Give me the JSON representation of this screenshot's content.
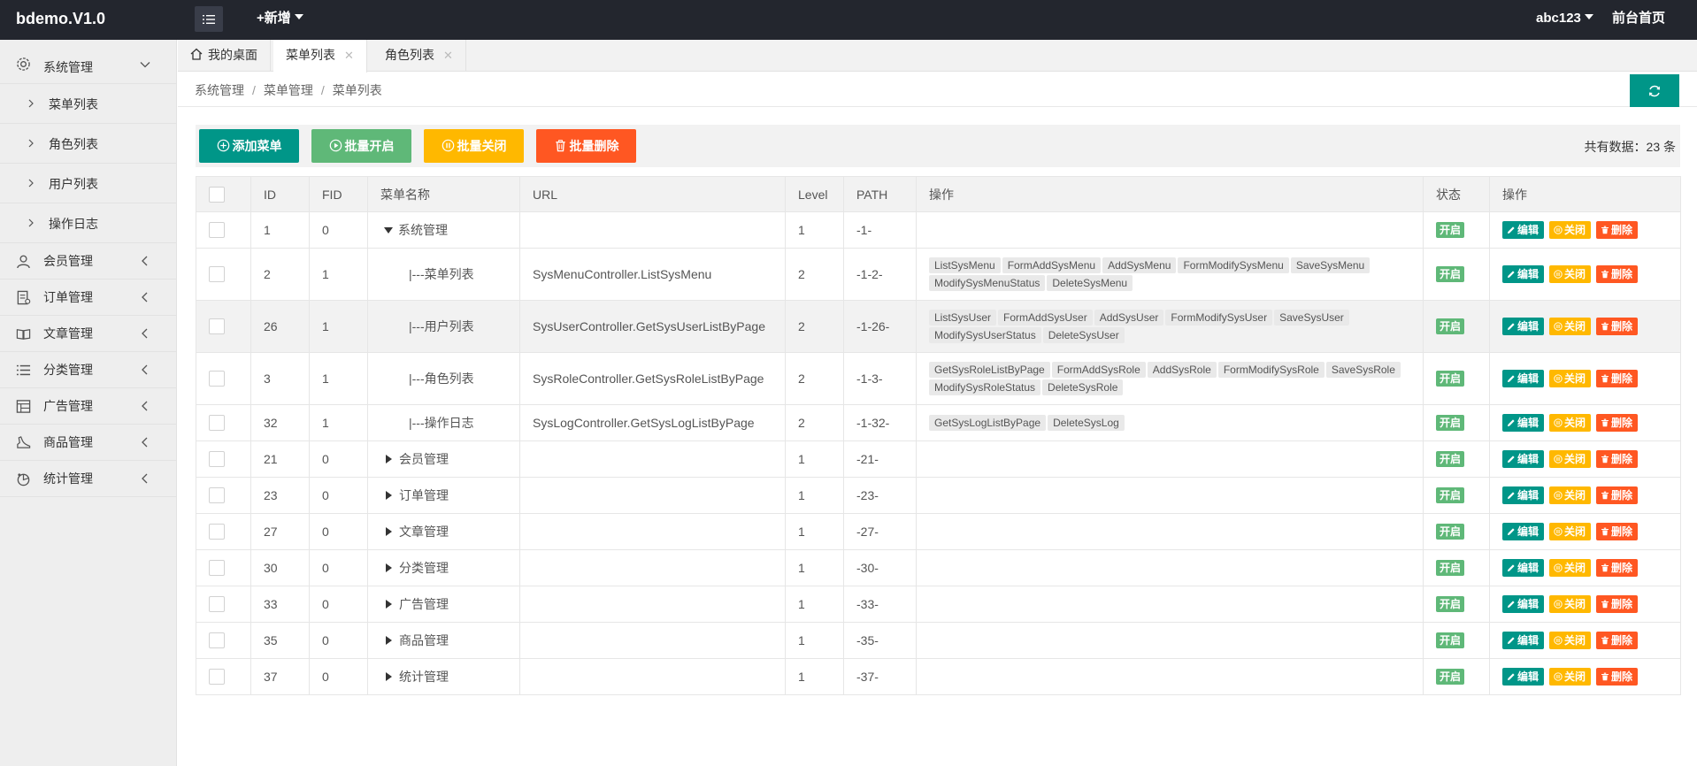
{
  "app": {
    "logo": "bdemo.V1.0",
    "add_new": "+新增",
    "user": "abc123",
    "front_home": "前台首页"
  },
  "sidebar": {
    "system": {
      "label": "系统管理",
      "subitems": [
        "菜单列表",
        "角色列表",
        "用户列表",
        "操作日志"
      ]
    },
    "groups": [
      "会员管理",
      "订单管理",
      "文章管理",
      "分类管理",
      "广告管理",
      "商品管理",
      "统计管理"
    ]
  },
  "tabs": [
    {
      "label": "我的桌面"
    },
    {
      "label": "菜单列表"
    },
    {
      "label": "角色列表"
    }
  ],
  "breadcrumb": [
    "系统管理",
    "菜单管理",
    "菜单列表"
  ],
  "toolbar": {
    "add": "添加菜单",
    "batch_on": "批量开启",
    "batch_off": "批量关闭",
    "batch_delete": "批量删除",
    "total": "共有数据：23 条"
  },
  "colors": {
    "teal": "#009688",
    "green": "#5fb878",
    "yellow": "#ffb800",
    "red": "#ff5722",
    "topbar": "#23262e"
  },
  "table": {
    "headers": [
      "ID",
      "FID",
      "菜单名称",
      "URL",
      "Level",
      "PATH",
      "操作",
      "状态",
      "操作"
    ],
    "status_label": "开启",
    "actions": {
      "edit": "编辑",
      "off": "关闭",
      "del": "删除"
    },
    "rows": [
      {
        "id": "1",
        "fid": "0",
        "name": "系统管理",
        "url": "",
        "level": "1",
        "path": "-1-",
        "perms": []
      },
      {
        "id": "2",
        "fid": "1",
        "name": "|---菜单列表",
        "url": "SysMenuController.ListSysMenu",
        "level": "2",
        "path": "-1-2-",
        "perms": [
          "ListSysMenu",
          "FormAddSysMenu",
          "AddSysMenu",
          "FormModifySysMenu",
          "SaveSysMenu",
          "ModifySysMenuStatus",
          "DeleteSysMenu"
        ]
      },
      {
        "id": "26",
        "fid": "1",
        "name": "|---用户列表",
        "url": "SysUserController.GetSysUserListByPage",
        "level": "2",
        "path": "-1-26-",
        "perms": [
          "ListSysUser",
          "FormAddSysUser",
          "AddSysUser",
          "FormModifySysUser",
          "SaveSysUser",
          "ModifySysUserStatus",
          "DeleteSysUser"
        ]
      },
      {
        "id": "3",
        "fid": "1",
        "name": "|---角色列表",
        "url": "SysRoleController.GetSysRoleListByPage",
        "level": "2",
        "path": "-1-3-",
        "perms": [
          "GetSysRoleListByPage",
          "FormAddSysRole",
          "AddSysRole",
          "FormModifySysRole",
          "SaveSysRole",
          "ModifySysRoleStatus",
          "DeleteSysRole"
        ]
      },
      {
        "id": "32",
        "fid": "1",
        "name": "|---操作日志",
        "url": "SysLogController.GetSysLogListByPage",
        "level": "2",
        "path": "-1-32-",
        "perms": [
          "GetSysLogListByPage",
          "DeleteSysLog"
        ]
      },
      {
        "id": "21",
        "fid": "0",
        "name": "会员管理",
        "url": "",
        "level": "1",
        "path": "-21-",
        "perms": []
      },
      {
        "id": "23",
        "fid": "0",
        "name": "订单管理",
        "url": "",
        "level": "1",
        "path": "-23-",
        "perms": []
      },
      {
        "id": "27",
        "fid": "0",
        "name": "文章管理",
        "url": "",
        "level": "1",
        "path": "-27-",
        "perms": []
      },
      {
        "id": "30",
        "fid": "0",
        "name": "分类管理",
        "url": "",
        "level": "1",
        "path": "-30-",
        "perms": []
      },
      {
        "id": "33",
        "fid": "0",
        "name": "广告管理",
        "url": "",
        "level": "1",
        "path": "-33-",
        "perms": []
      },
      {
        "id": "35",
        "fid": "0",
        "name": "商品管理",
        "url": "",
        "level": "1",
        "path": "-35-",
        "perms": []
      },
      {
        "id": "37",
        "fid": "0",
        "name": "统计管理",
        "url": "",
        "level": "1",
        "path": "-37-",
        "perms": []
      }
    ]
  }
}
